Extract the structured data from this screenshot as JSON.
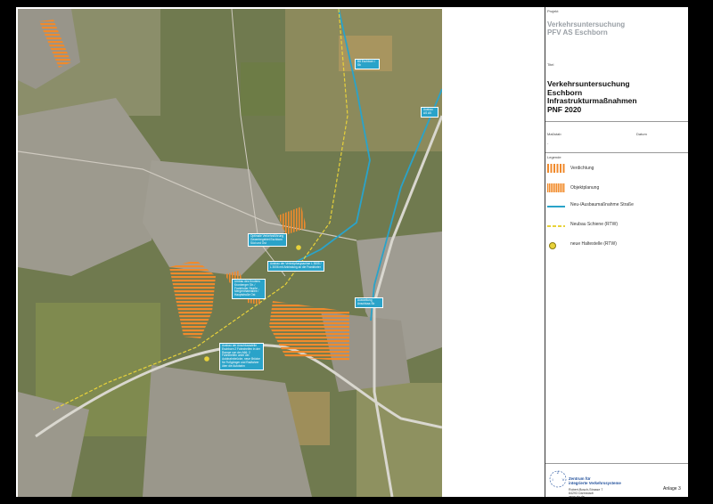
{
  "panel": {
    "projekt_label": "Projekt",
    "projekt_line1": "Verkehrsuntersuchung",
    "projekt_line2": "PFV AS Eschborn",
    "titel_label": "Titel",
    "titel_lines": [
      "Verkehrsuntersuchung",
      "Eschborn",
      "Infrastrukturmaßnahmen",
      "PNF 2020"
    ],
    "massstab_label": "Maßstab",
    "massstab_value": "-",
    "datum_label": "Datum",
    "legende_label": "Legende",
    "legend": [
      {
        "symbol": "orange-stripes",
        "label": "Verdichtung"
      },
      {
        "symbol": "orange-hatch",
        "label": "Objektplanung"
      },
      {
        "symbol": "blue-line",
        "label": "Neu-/Ausbaumaßnahme Straße"
      },
      {
        "symbol": "yellow-dashed-line",
        "label": "Neubau Schiene (RTW)"
      },
      {
        "symbol": "yellow-dot",
        "label": "neue Haltestelle (RTW)"
      }
    ],
    "org_line1": "Zentrum für",
    "org_line2": "integrierte Verkehrssysteme",
    "addr_line1": "Robert-Bosch-Strasse 7",
    "addr_line2": "64293 Darmstadt",
    "addr_line3": "www.ziv.de",
    "anlage": "Anlage 3",
    "logo_letters": [
      "Z",
      "I",
      "V"
    ]
  },
  "map": {
    "callouts": [
      {
        "id": "a",
        "text": "B8 Eschborn / Sb"
      },
      {
        "id": "b",
        "text": "Ausbau AS A5"
      },
      {
        "id": "c",
        "text": "Optimale Verkehrsführung Gewerbegebiet Eschborn Süd und Ost"
      },
      {
        "id": "d",
        "text": "Ausbau der Verknüpfungsachse L 3005 / L 3006 mit Anbindung an die Frankfurter"
      },
      {
        "id": "e",
        "text": "Umbau des Knotens Kronberger Str. / Frankfurter Straße - Mergenthalerallee / Hauptstraße Ost"
      },
      {
        "id": "f",
        "text": "Ausbau der Anschlussstelle Eschborn 2 Fahrstreifen in der Rampe von der A66; 2 Fahrstreifen unter der Autobahnbrücke, neue Brücke für Fußgänger und Radfahrer über die Autobahn"
      },
      {
        "id": "g",
        "text": "Ausweitung Anschluss Sb"
      }
    ],
    "colors": {
      "orange": "#f08a2c",
      "blue": "#2aa3c9",
      "yellow": "#e8d23a",
      "urban": "#9c9a8f",
      "field_green": "#7d8a4e",
      "field_brown": "#a89466"
    }
  }
}
